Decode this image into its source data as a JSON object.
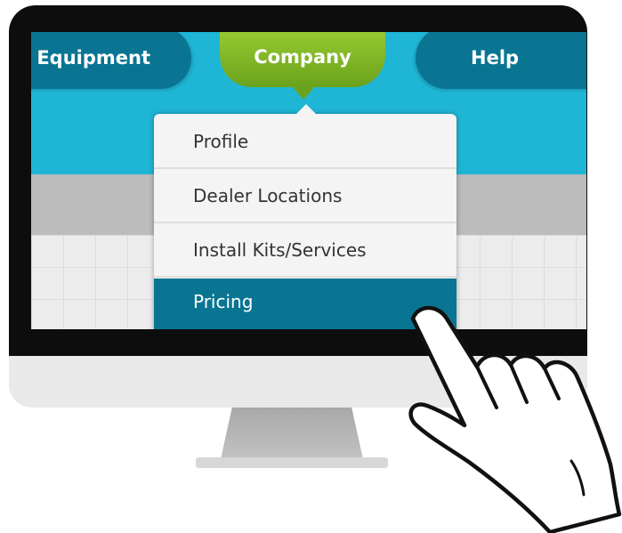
{
  "nav": {
    "equipment_label": "Equipment",
    "company_label": "Company",
    "help_label": "Help"
  },
  "dropdown": {
    "items": [
      {
        "label": "Profile"
      },
      {
        "label": "Dealer Locations"
      },
      {
        "label": "Install Kits/Services"
      },
      {
        "label": "Pricing",
        "active": true
      }
    ]
  },
  "colors": {
    "nav_blue": "#0a7592",
    "company_green": "#7fb426",
    "hero_cyan": "#1fb6d6",
    "active_item": "#0a7592"
  },
  "icons": {
    "pointer": "pointing-hand-icon"
  }
}
